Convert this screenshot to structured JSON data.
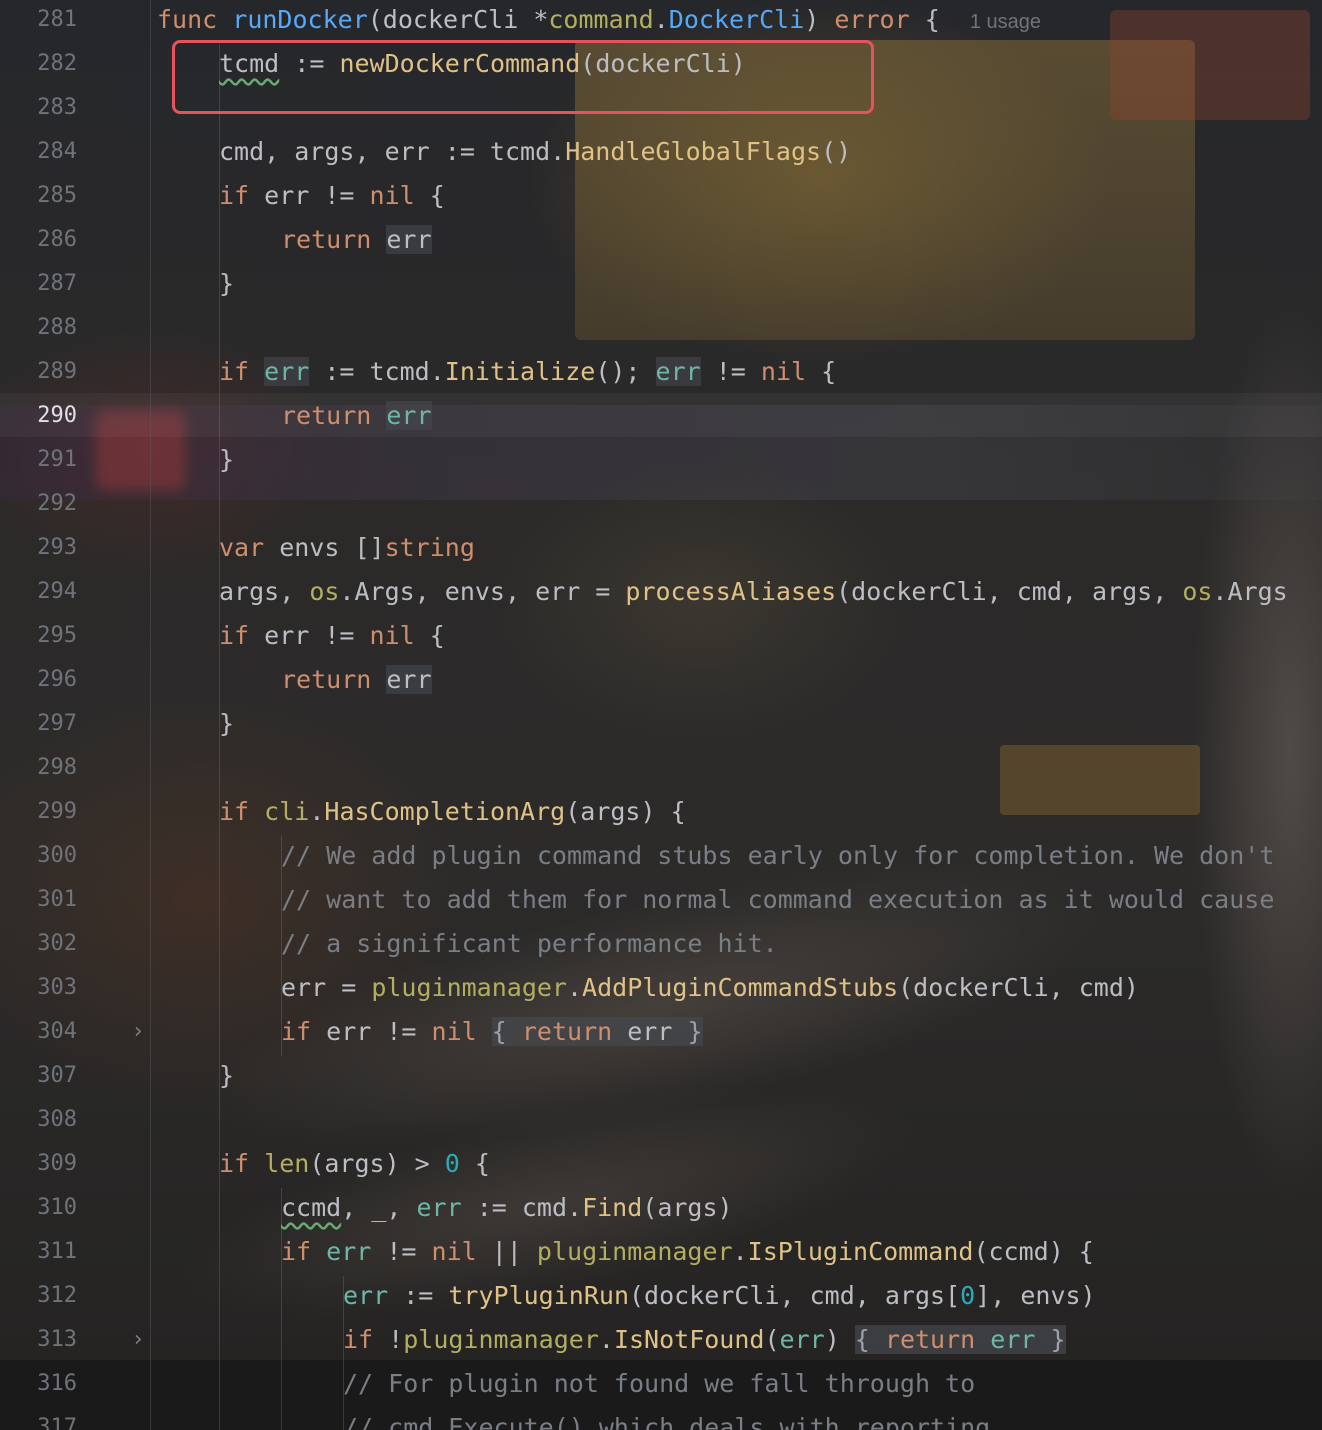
{
  "editor": {
    "function_usage_hint": "1 usage",
    "current_line": "290",
    "line_numbers": [
      "281",
      "282",
      "283",
      "284",
      "285",
      "286",
      "287",
      "288",
      "289",
      "290",
      "291",
      "292",
      "293",
      "294",
      "295",
      "296",
      "297",
      "298",
      "299",
      "300",
      "301",
      "302",
      "303",
      "304",
      "307",
      "308",
      "309",
      "310",
      "311",
      "312",
      "313",
      "316",
      "317"
    ],
    "folded_lines": [
      "304",
      "313"
    ]
  },
  "code": {
    "l281": {
      "func": "func",
      "name": "runDocker",
      "paren": "(dockerCli *",
      "pkg": "command",
      "dot": ".",
      "type": "DockerCli",
      "close": ") ",
      "ret": "error",
      "brace": " {  "
    },
    "l282": {
      "var": "tcmd",
      "op": " := ",
      "call": "newDockerCommand",
      "args": "(dockerCli)"
    },
    "l284": {
      "lhs": "cmd, args, err := tcmd.",
      "method": "HandleGlobalFlags",
      "tail": "()"
    },
    "l285": {
      "if": "if",
      "cond": " err != ",
      "nil": "nil",
      "tail": " {"
    },
    "l286": {
      "ret": "return",
      "val": "err"
    },
    "l287": {
      "brace": "}"
    },
    "l289": {
      "if": "if",
      "a": " ",
      "err1": "err",
      "b": " := tcmd.",
      "method": "Initialize",
      "c": "(); ",
      "err2": "err",
      "d": " != ",
      "nil": "nil",
      "e": " {"
    },
    "l290": {
      "ret": "return",
      "val": "err"
    },
    "l291": {
      "brace": "}"
    },
    "l293": {
      "var": "var",
      "mid": " envs []",
      "type": "string"
    },
    "l294": {
      "a": "args, ",
      "os1": "os",
      "b": ".Args, envs, err = ",
      "call": "processAliases",
      "c": "(dockerCli, cmd, args, ",
      "os2": "os",
      "d": ".Args"
    },
    "l295": {
      "if": "if",
      "cond": " err != ",
      "nil": "nil",
      "tail": " {"
    },
    "l296": {
      "ret": "return",
      "val": "err"
    },
    "l297": {
      "brace": "}"
    },
    "l299": {
      "if": "if",
      "a": " ",
      "pkg": "cli",
      "b": ".",
      "method": "HasCompletionArg",
      "c": "(args) {"
    },
    "l300": {
      "comment": "// We add plugin command stubs early only for completion. We don't"
    },
    "l301": {
      "comment": "// want to add them for normal command execution as it would cause"
    },
    "l302": {
      "comment": "// a significant performance hit."
    },
    "l303": {
      "a": "err = ",
      "pkg": "pluginmanager",
      "b": ".",
      "method": "AddPluginCommandStubs",
      "c": "(dockerCli, cmd)"
    },
    "l304": {
      "if": "if",
      "a": " err != ",
      "nil": "nil",
      "b": " ",
      "fold_open": "{ ",
      "ret": "return",
      "c": " err ",
      "fold_close": "}"
    },
    "l307": {
      "brace": "}"
    },
    "l309": {
      "if": "if",
      "a": " ",
      "builtin": "len",
      "b": "(args) > ",
      "num": "0",
      "c": " {"
    },
    "l310": {
      "var": "ccmd",
      "a": ", _, ",
      "err": "err",
      "b": " := cmd.",
      "method": "Find",
      "c": "(args)"
    },
    "l311": {
      "if": "if",
      "a": " ",
      "err": "err",
      "b": " != ",
      "nil": "nil",
      "c": " || ",
      "pkg": "pluginmanager",
      "d": ".",
      "method": "IsPluginCommand",
      "e": "(ccmd) {"
    },
    "l312": {
      "err": "err",
      "a": " := ",
      "call": "tryPluginRun",
      "b": "(dockerCli, cmd, args[",
      "num": "0",
      "c": "], envs)"
    },
    "l313": {
      "if": "if",
      "a": " !",
      "pkg": "pluginmanager",
      "b": ".",
      "method": "IsNotFound",
      "c": "(",
      "err1": "err",
      "d": ") ",
      "fold_open": "{ ",
      "ret": "return",
      "e": " ",
      "err2": "err",
      "f": " ",
      "fold_close": "}"
    },
    "l316": {
      "comment": "// For plugin not found we fall through to"
    },
    "l317": {
      "comment": "// cmd.Execute() which deals with reporting"
    }
  },
  "colors": {
    "annotation_box": "#e5535d",
    "keyword": "#cf8e6d",
    "function": "#57aaf7",
    "method": "#e0c287",
    "package": "#b3ae60",
    "comment": "#7a7e85",
    "number": "#2aacb8",
    "text": "#bcbec4"
  }
}
